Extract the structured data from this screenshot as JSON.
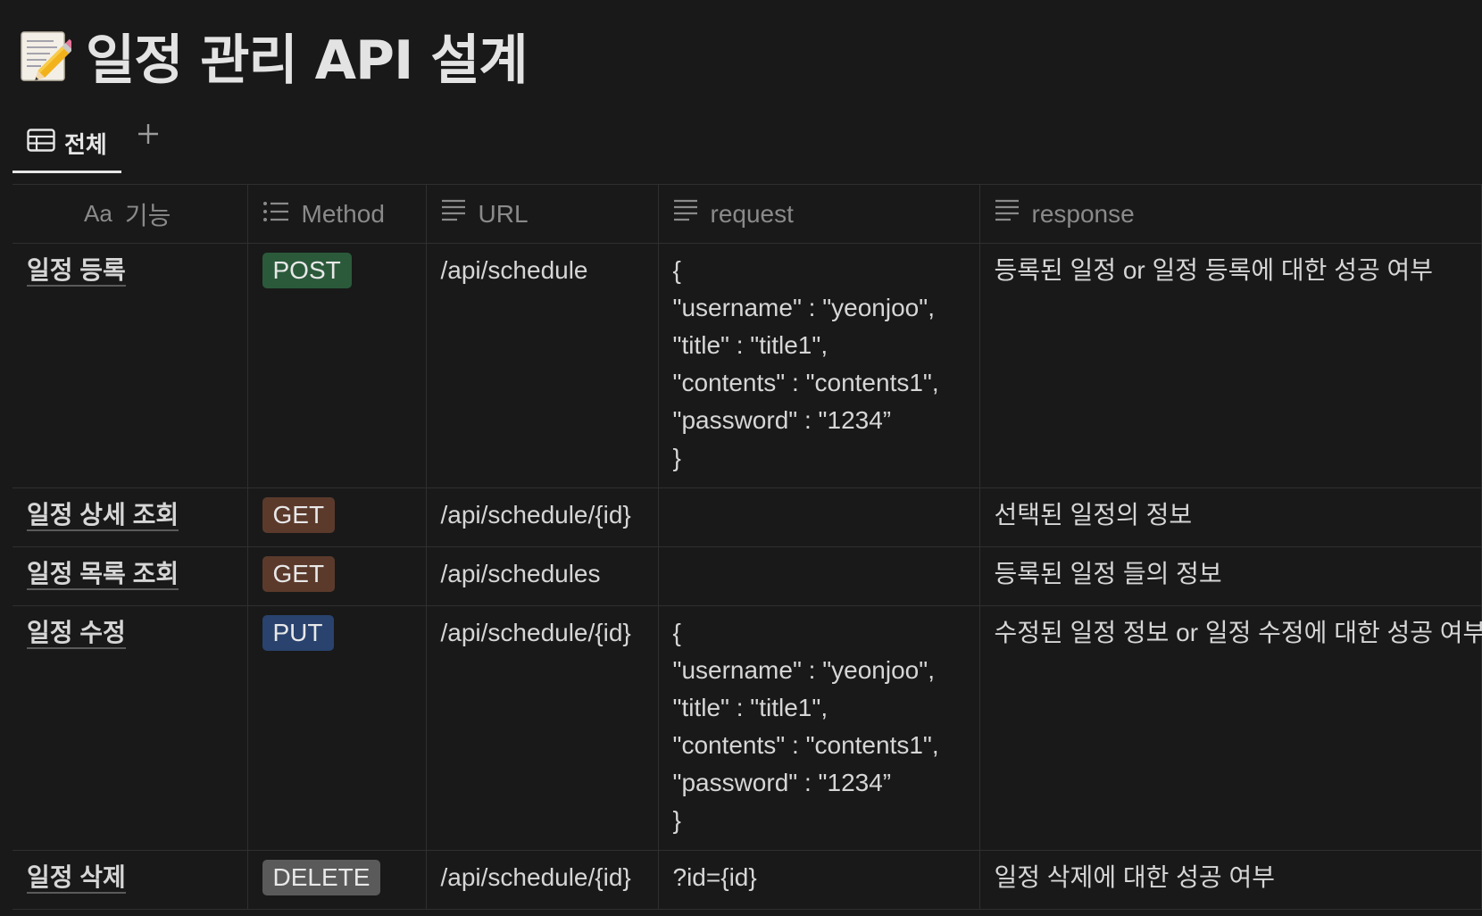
{
  "page": {
    "title": "일정 관리 API 설계",
    "icon": "memo-pencil-icon"
  },
  "views": {
    "active_tab": "전체",
    "add_label": "+"
  },
  "table": {
    "columns": [
      {
        "label": "기능",
        "prefix": "Aa",
        "icon": "title-property-icon"
      },
      {
        "label": "Method",
        "icon": "list-icon"
      },
      {
        "label": "URL",
        "icon": "text-icon"
      },
      {
        "label": "request",
        "icon": "text-icon"
      },
      {
        "label": "response",
        "icon": "text-icon"
      }
    ],
    "rows": [
      {
        "name": "일정 등록",
        "method": "POST",
        "method_color": "#2b5a3b",
        "url": "/api/schedule",
        "request": [
          "{",
          "\"username\" : \"yeonjoo\",",
          "\"title\" : \"title1\",",
          "\"contents\" : \"contents1\",",
          "\"password\" : \"1234”",
          "}"
        ],
        "response": "등록된 일정 or  일정 등록에 대한 성공 여부"
      },
      {
        "name": "일정 상세  조회",
        "method": "GET",
        "method_color": "#5b3a2c",
        "url": "/api/schedule/{id}",
        "request": [],
        "response": "선택된 일정의 정보"
      },
      {
        "name": "일정 목록 조회",
        "method": "GET",
        "method_color": "#5b3a2c",
        "url": "/api/schedules",
        "request": [],
        "response": "등록된 일정 들의 정보"
      },
      {
        "name": "일정 수정",
        "method": "PUT",
        "method_color": "#29426e",
        "url": "/api/schedule/{id}",
        "request": [
          "{",
          "\"username\" : \"yeonjoo\",",
          "\"title\" : \"title1\",",
          "\"contents\" : \"contents1\",",
          "\"password\" : \"1234”",
          "}"
        ],
        "response": "수정된 일정 정보 or 일정 수정에 대한 성공 여부"
      },
      {
        "name": "일정 삭제",
        "method": "DELETE",
        "method_color": "#5a5a5a",
        "url": "/api/schedule/{id}",
        "request": [
          "?id={id}"
        ],
        "response": "일정 삭제에 대한 성공 여부"
      }
    ]
  }
}
